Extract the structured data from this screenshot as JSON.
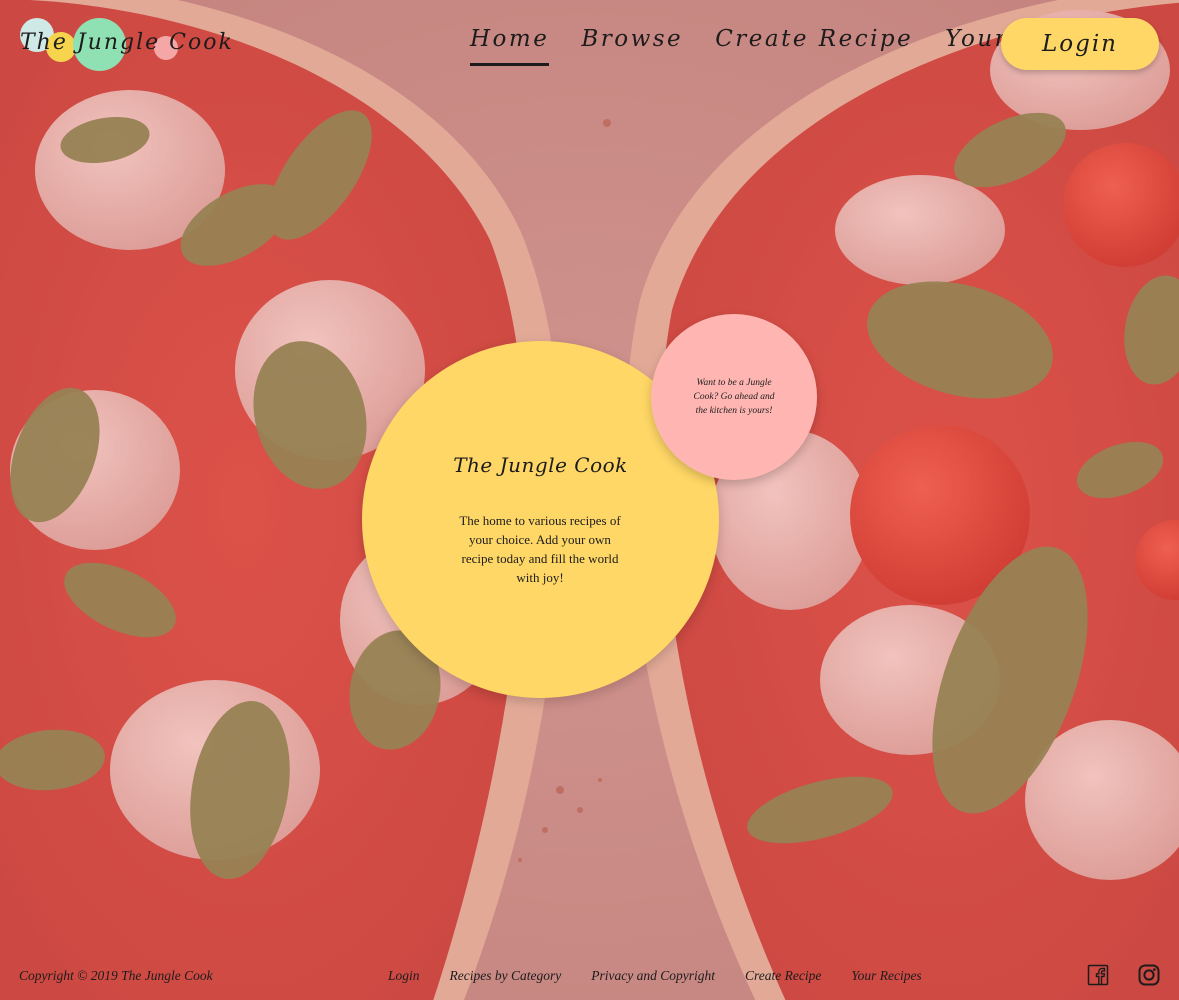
{
  "brand": {
    "logo_text": "The Jungle Cook"
  },
  "nav": {
    "items": [
      {
        "label": "Home",
        "active": true
      },
      {
        "label": "Browse",
        "active": false
      },
      {
        "label": "Create Recipe",
        "active": false
      },
      {
        "label": "Your Recipes",
        "active": false
      }
    ],
    "login_label": "Login"
  },
  "hero": {
    "title": "The Jungle Cook",
    "description": "The home to various recipes of your choice. Add your own recipe today and fill the world with joy!",
    "bubble_text": "Want to be a Jungle Cook? Go ahead and the kitchen is yours!"
  },
  "footer": {
    "copyright": "Copyright © 2019 The Jungle Cook",
    "links": [
      {
        "label": "Login"
      },
      {
        "label": "Recipes by Category"
      },
      {
        "label": "Privacy and Copyright"
      },
      {
        "label": "Create Recipe"
      },
      {
        "label": "Your Recipes"
      }
    ],
    "social_icons": [
      "facebook-icon",
      "instagram-icon"
    ]
  },
  "colors": {
    "accent_yellow": "#ffd766",
    "bubble_pink": "#ffb6b2",
    "logo_green": "#8fe0b2",
    "logo_mint": "#cfe9e6",
    "text_dark": "#1c1c1c"
  }
}
